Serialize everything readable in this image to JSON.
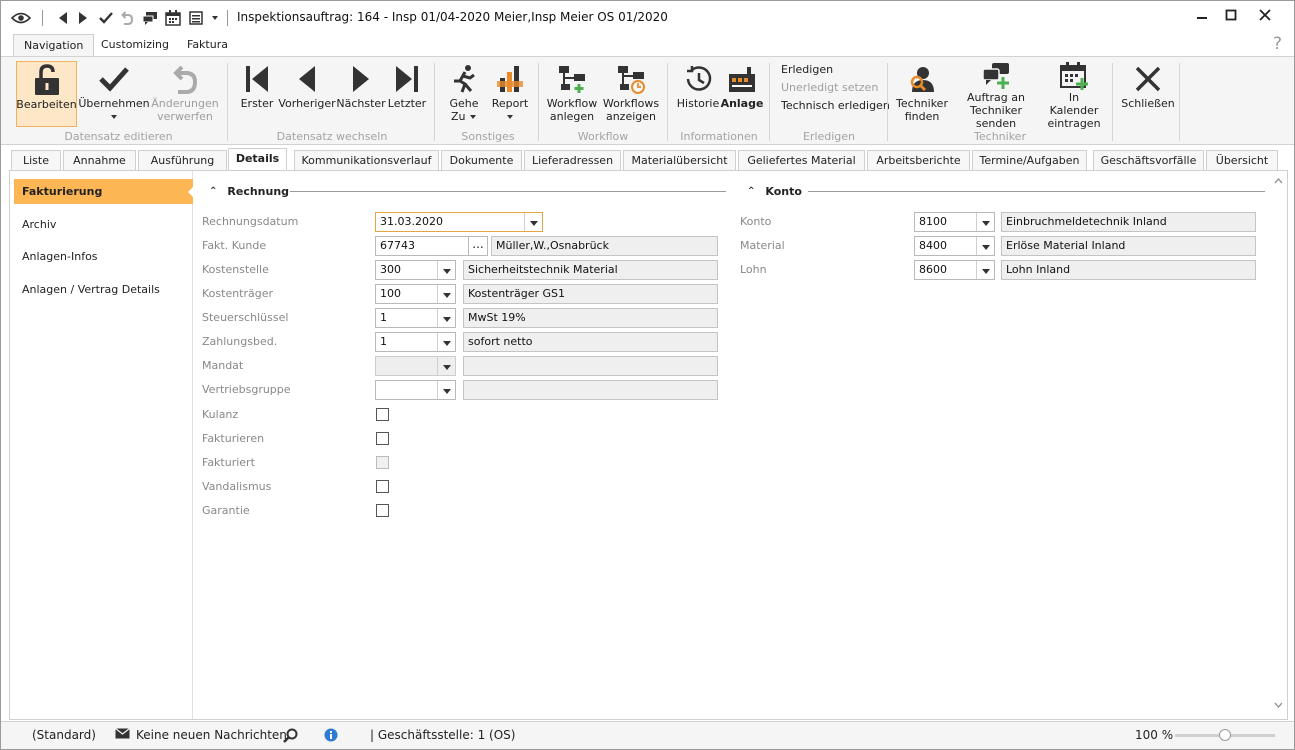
{
  "window": {
    "title": "Inspektionsauftrag: 164 - Insp 01/04-2020 Meier,Insp Meier OS 01/2020"
  },
  "ribbon_tabs": [
    {
      "label": "Navigation"
    },
    {
      "label": "Customizing"
    },
    {
      "label": "Faktura"
    }
  ],
  "help_label": "?",
  "ribbon": {
    "groups": {
      "datensatz_editieren": "Datensatz editieren",
      "datensatz_wechseln": "Datensatz wechseln",
      "sonstiges": "Sonstiges",
      "workflow": "Workflow",
      "informationen": "Informationen",
      "erledigen": "Erledigen",
      "techniker": "Techniker"
    },
    "buttons": {
      "bearbeiten": "Bearbeiten",
      "uebernehmen": "Übernehmen",
      "aenderungen_1": "Änderungen",
      "aenderungen_2": "verwerfen",
      "erster": "Erster",
      "vorheriger": "Vorheriger",
      "naechster": "Nächster",
      "letzter": "Letzter",
      "gehe_1": "Gehe",
      "gehe_2": "Zu",
      "report": "Report",
      "wf_anlegen_1": "Workflow",
      "wf_anlegen_2": "anlegen",
      "wf_anzeigen_1": "Workflows",
      "wf_anzeigen_2": "anzeigen",
      "historie": "Historie",
      "anlage": "Anlage",
      "erledigen": "Erledigen",
      "unerledigt": "Unerledigt setzen",
      "technisch": "Technisch erledigen",
      "tech_finden_1": "Techniker",
      "tech_finden_2": "finden",
      "auftrag_1": "Auftrag an",
      "auftrag_2": "Techniker senden",
      "kalender_1": "In Kalender",
      "kalender_2": "eintragen",
      "schliessen": "Schließen"
    }
  },
  "detail_tabs": [
    {
      "label": "Liste"
    },
    {
      "label": "Annahme"
    },
    {
      "label": "Ausführung"
    },
    {
      "label": "Details"
    },
    {
      "label": "Kommunikationsverlauf"
    },
    {
      "label": "Dokumente"
    },
    {
      "label": "Lieferadressen"
    },
    {
      "label": "Materialübersicht"
    },
    {
      "label": "Geliefertes Material"
    },
    {
      "label": "Arbeitsberichte"
    },
    {
      "label": "Termine/Aufgaben"
    },
    {
      "label": "Geschäftsvorfälle"
    },
    {
      "label": "Übersicht"
    }
  ],
  "left_nav": [
    {
      "label": "Fakturierung"
    },
    {
      "label": "Archiv"
    },
    {
      "label": "Anlagen-Infos"
    },
    {
      "label": "Anlagen / Vertrag Details"
    }
  ],
  "rechnung": {
    "title": "Rechnung",
    "labels": {
      "rechnungsdatum": "Rechnungsdatum",
      "kunde": "Fakt. Kunde",
      "kostenstelle": "Kostenstelle",
      "kostentraeger": "Kostenträger",
      "steuer": "Steuerschlüssel",
      "zahlung": "Zahlungsbed.",
      "mandat": "Mandat",
      "vertrieb": "Vertriebsgruppe",
      "kulanz": "Kulanz",
      "fakturieren": "Fakturieren",
      "fakturiert": "Fakturiert",
      "vandalismus": "Vandalismus",
      "garantie": "Garantie"
    },
    "values": {
      "rechnungsdatum": "31.03.2020",
      "kunde_nr": "67743",
      "kunde_ellipsis": "...",
      "kunde_name": "Müller,W.,Osnabrück",
      "kostenstelle_code": "300",
      "kostenstelle_name": "Sicherheitstechnik Material",
      "kostentraeger_code": "100",
      "kostentraeger_name": "Kostenträger GS1",
      "steuer_code": "1",
      "steuer_name": "MwSt 19%",
      "zahlung_code": "1",
      "zahlung_name": "sofort netto",
      "mandat_code": "",
      "mandat_name": "",
      "vertrieb_code": "",
      "vertrieb_name": ""
    }
  },
  "konto": {
    "title": "Konto",
    "rows": [
      {
        "label": "Konto",
        "code": "8100",
        "name": "Einbruchmeldetechnik Inland"
      },
      {
        "label": "Material",
        "code": "8400",
        "name": "Erlöse Material Inland"
      },
      {
        "label": "Lohn",
        "code": "8600",
        "name": "Lohn Inland"
      }
    ]
  },
  "status": {
    "standard": "(Standard)",
    "messages": "Keine neuen Nachrichten",
    "geschaeftsstelle": "| Geschäftsstelle:  1 (OS)",
    "zoom": "100 %",
    "zoom_level": 0.5
  },
  "colors": {
    "accent": "#fdb654",
    "selected_bg": "#fde7c6",
    "info_blue": "#2e7bd6"
  }
}
